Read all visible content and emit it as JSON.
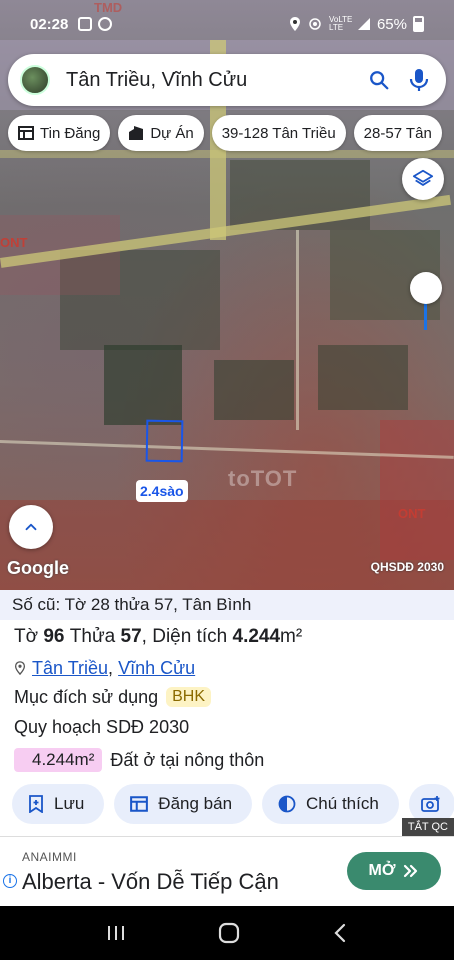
{
  "status_bar": {
    "time": "02:28",
    "network": "VoLTE LTE",
    "battery": "65%"
  },
  "search": {
    "query": "Tân Triều, Vĩnh Cửu",
    "icon_search": "search-icon",
    "icon_mic": "mic-icon"
  },
  "chips": [
    {
      "label": "Tin Đăng",
      "icon": "listing-icon"
    },
    {
      "label": "Dự Án",
      "icon": "building-icon"
    },
    {
      "label": "39-128 Tân Triều",
      "icon": ""
    },
    {
      "label": "28-57 Tân",
      "icon": ""
    }
  ],
  "map": {
    "parcel_label": "2.4sào",
    "watermark": "toTOT",
    "zone_labels": [
      "ONT",
      "ONT",
      "TMD"
    ],
    "attribution": "Google",
    "layer_name": "QHSDĐ 2030",
    "accent_color": "#1a56e8"
  },
  "parcel": {
    "old_reference": "Số cũ: Tờ 28 thửa 57, Tân Bình",
    "sheet_label": "Tờ",
    "sheet_no": "96",
    "plot_label": "Thửa",
    "plot_no": "57",
    "area_label": "Diện tích",
    "area_value": "4.244",
    "area_unit": "m²",
    "commune": "Tân Triều",
    "district": "Vĩnh Cửu",
    "separator": ",",
    "purpose_label": "Mục đích sử dụng",
    "purpose_code": "BHK",
    "plan_label": "Quy hoạch SDĐ 2030",
    "plan_area": "4.244m²",
    "plan_use": "Đất ở tại nông thôn"
  },
  "actions": [
    {
      "label": "Lưu",
      "icon": "bookmark-add-icon"
    },
    {
      "label": "Đăng bán",
      "icon": "listing-icon"
    },
    {
      "label": "Chú thích",
      "icon": "legend-icon"
    }
  ],
  "ad": {
    "close_label": "TẮT QC",
    "advertiser": "ANAIMMI",
    "headline": "Alberta - Vốn Dễ Tiếp Cận",
    "cta": "MỞ"
  }
}
